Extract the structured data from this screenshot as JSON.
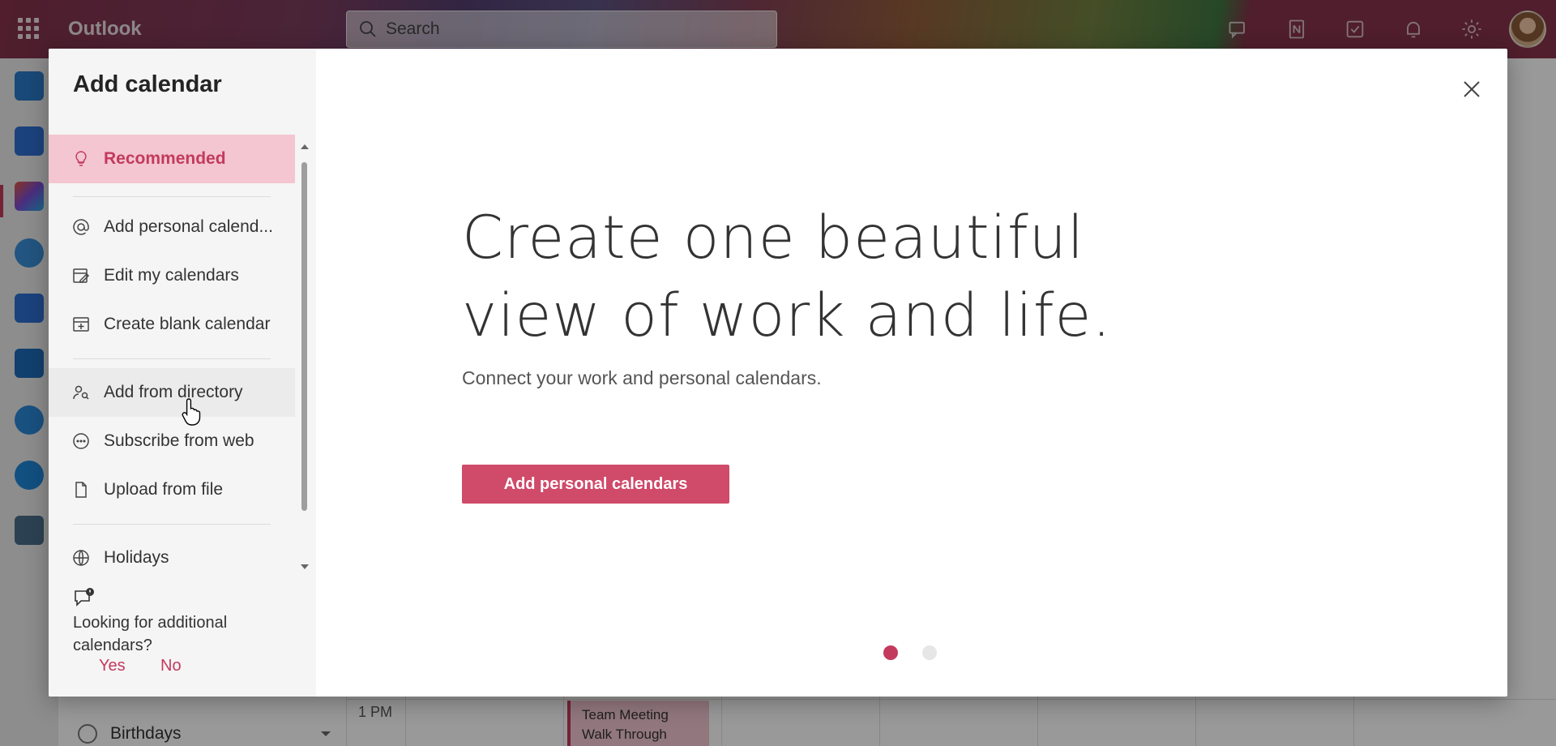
{
  "topbar": {
    "app_name": "Outlook",
    "search_placeholder": "Search"
  },
  "background": {
    "time_label": "1 PM",
    "event_title": "Team Meeting Walk Through",
    "calendar_item": "Birthdays"
  },
  "dialog": {
    "title": "Add calendar",
    "nav": [
      {
        "label": "Recommended",
        "icon": "lightbulb-icon",
        "active": true
      },
      {
        "label": "Add personal calend...",
        "icon": "at-icon"
      },
      {
        "label": "Edit my calendars",
        "icon": "edit-calendar-icon"
      },
      {
        "label": "Create blank calendar",
        "icon": "calendar-add-icon"
      },
      {
        "label": "Add from directory",
        "icon": "people-search-icon",
        "hover": true
      },
      {
        "label": "Subscribe from web",
        "icon": "ellipsis-circle-icon"
      },
      {
        "label": "Upload from file",
        "icon": "document-icon"
      },
      {
        "label": "Holidays",
        "icon": "globe-icon"
      }
    ],
    "feedback": {
      "question": "Looking for additional calendars?",
      "yes": "Yes",
      "no": "No"
    },
    "headline_line1": "Create one beautiful",
    "headline_line2": "view of work and life.",
    "subtext": "Connect your work and personal calendars.",
    "cta_label": "Add personal calendars",
    "carousel": {
      "current": 1,
      "total": 2
    },
    "accent_color": "#c33a5d"
  }
}
